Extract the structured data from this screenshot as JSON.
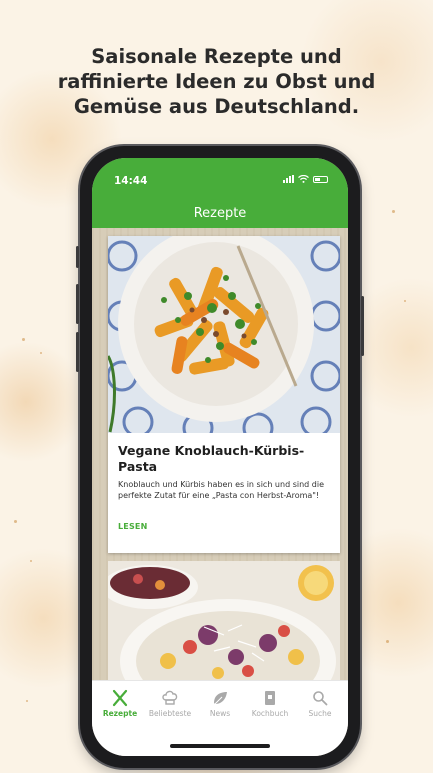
{
  "headline": {
    "line1": "Saisonale Rezepte und",
    "line2": "raffinierte Ideen zu Obst und",
    "line3": "Gemüse aus Deutschland."
  },
  "status_bar": {
    "time": "14:44"
  },
  "app_bar": {
    "title": "Rezepte"
  },
  "recipe_card": {
    "title": "Vegane Knoblauch-Kürbis-Pasta",
    "description": "Knoblauch und Kürbis haben es in sich und sind die perfekte Zutat für eine „Pasta con Herbst-Aroma\"!",
    "link": "LESEN"
  },
  "tabs": [
    {
      "label": "Rezepte",
      "icon": "fork-knife-icon",
      "active": true
    },
    {
      "label": "Beliebteste",
      "icon": "chef-hat-icon",
      "active": false
    },
    {
      "label": "News",
      "icon": "leaf-icon",
      "active": false
    },
    {
      "label": "Kochbuch",
      "icon": "book-icon",
      "active": false
    },
    {
      "label": "Suche",
      "icon": "search-icon",
      "active": false
    }
  ],
  "colors": {
    "brand_green": "#48ad3a",
    "inactive_tab": "#a9a9a9",
    "background": "#fbf3e6"
  }
}
